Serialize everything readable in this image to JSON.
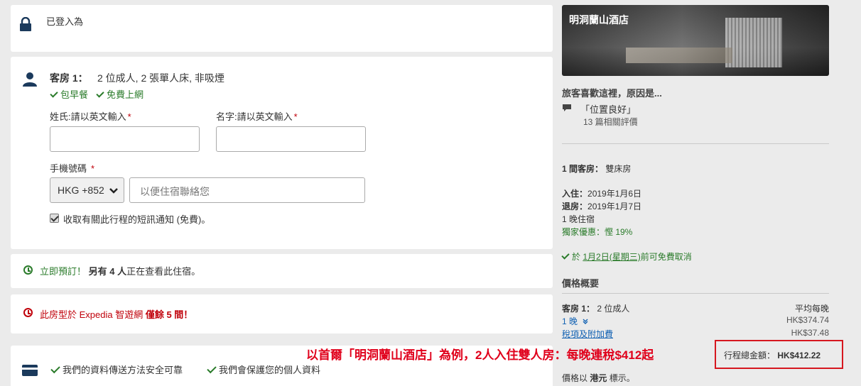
{
  "signin": {
    "label": "已登入為"
  },
  "room": {
    "label": "客房 1：",
    "desc": "2 位成人, 2 張單人床, 非吸煙",
    "amenity_breakfast": "包早餐",
    "amenity_wifi": "免費上網",
    "lastname_label": "姓氏:請以英文輸入",
    "firstname_label": "名字:請以英文輸入",
    "phone_label": "手機號碼",
    "country_code": "HKG +852",
    "phone_placeholder": "以便住宿聯絡您",
    "sms_label": "收取有關此行程的短訊通知 (免費)。"
  },
  "notices": {
    "book_now": "立即預訂！",
    "viewers_a": "另有",
    "viewers_count": "4 人",
    "viewers_b": "正在查看此住宿。",
    "scarcity_a": "此房型於 Expedia 智遊網",
    "scarcity_b": "僅餘 5 間！"
  },
  "security": {
    "item1": "我們的資料傳送方法安全可靠",
    "item2": "我們會保護您的個人資料"
  },
  "hotel": {
    "name": "明洞蘭山酒店",
    "like_heading": "旅客喜歡這裡，原因是...",
    "like_reason": "「位置良好」",
    "review_count": "13 篇相關評價"
  },
  "summary": {
    "rooms_label": "1 間客房：",
    "room_type": "雙床房",
    "checkin_label": "入住：",
    "checkin_date": "2019年1月6日",
    "checkout_label": "退房：",
    "checkout_date": "2019年1月7日",
    "nights": "1 晚住宿",
    "discount": "獨家優惠：慳 19%",
    "cancel_pre": "於",
    "cancel_date": "1月2日(星期三)",
    "cancel_post": "前可免費取消",
    "price_heading": "價格概要",
    "price_room_label": "客房 1：",
    "price_room_guests": "2 位成人",
    "avg_label": "平均每晚",
    "night_link": "1 晚",
    "night_price": "HK$374.74",
    "tax_link": "稅項及附加費",
    "tax_price": "HK$37.48",
    "total_label": "行程總金額：",
    "total_value": "HK$412.22",
    "currency_note_a": "價格以",
    "currency_note_b": "港元",
    "currency_note_c": "標示。"
  },
  "annotation": {
    "text": "以首爾「明洞蘭山酒店」為例，2人入住雙人房：每晚連稅$412起"
  },
  "colors": {
    "green": "#2a7b2a",
    "red": "#c0000a",
    "link": "#1262b3",
    "navy": "#1b3a5c",
    "highlight": "#d6171f"
  }
}
